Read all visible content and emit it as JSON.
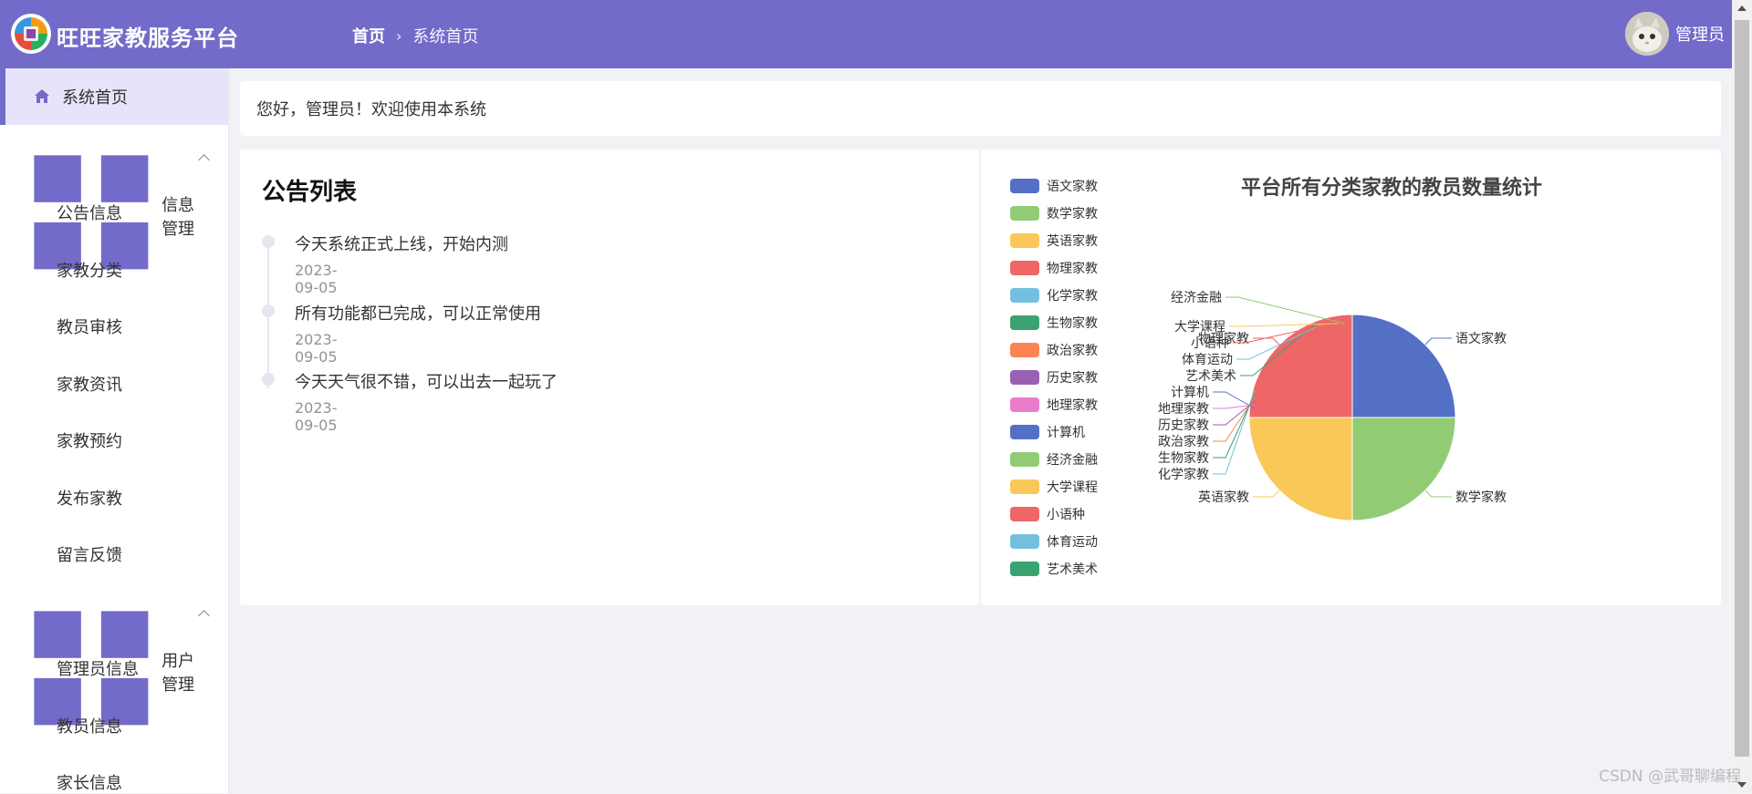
{
  "header": {
    "app_title": "旺旺家教服务平台",
    "breadcrumb_home": "首页",
    "breadcrumb_current": "系统首页",
    "username": "管理员",
    "accent_color": "#736bc9"
  },
  "sidebar": {
    "home": "系统首页",
    "groups": [
      {
        "label": "信息管理",
        "items": [
          "公告信息",
          "家教分类",
          "教员审核",
          "家教资讯",
          "家教预约",
          "发布家教",
          "留言反馈"
        ]
      },
      {
        "label": "用户管理",
        "items": [
          "管理员信息",
          "教员信息",
          "家长信息"
        ]
      }
    ]
  },
  "welcome": "您好，管理员！欢迎使用本系统",
  "notice": {
    "title": "公告列表",
    "items": [
      {
        "text": "今天系统正式上线，开始内测",
        "date": "2023-09-05"
      },
      {
        "text": "所有功能都已完成，可以正常使用",
        "date": "2023-09-05"
      },
      {
        "text": "今天天气很不错，可以出去一起玩了",
        "date": "2023-09-05"
      }
    ]
  },
  "chart_data": {
    "type": "pie",
    "title": "平台所有分类家教的教员数量统计",
    "legend_position": "left",
    "legend": [
      "语文家教",
      "数学家教",
      "英语家教",
      "物理家教",
      "化学家教",
      "生物家教",
      "政治家教",
      "历史家教",
      "地理家教",
      "计算机",
      "经济金融",
      "大学课程",
      "小语种",
      "体育运动",
      "艺术美术"
    ],
    "colors": [
      "#5470c6",
      "#91cc75",
      "#fac858",
      "#ee6666",
      "#73c0de",
      "#3ba272",
      "#fc8452",
      "#9a60b4",
      "#ea7ccc",
      "#5470c6",
      "#91cc75",
      "#fac858",
      "#ee6666",
      "#73c0de",
      "#3ba272"
    ],
    "slices": [
      {
        "name": "语文家教",
        "value": 1
      },
      {
        "name": "数学家教",
        "value": 1
      },
      {
        "name": "英语家教",
        "value": 1
      },
      {
        "name": "物理家教",
        "value": 1
      },
      {
        "name": "化学家教",
        "value": 0
      },
      {
        "name": "生物家教",
        "value": 0
      },
      {
        "name": "政治家教",
        "value": 0
      },
      {
        "name": "历史家教",
        "value": 0
      },
      {
        "name": "地理家教",
        "value": 0
      },
      {
        "name": "计算机",
        "value": 0
      },
      {
        "name": "艺术美术",
        "value": 0
      },
      {
        "name": "体育运动",
        "value": 0
      },
      {
        "name": "小语种",
        "value": 0
      },
      {
        "name": "大学课程",
        "value": 0
      },
      {
        "name": "经济金融",
        "value": 0
      }
    ]
  },
  "watermark": "CSDN @武哥聊编程"
}
